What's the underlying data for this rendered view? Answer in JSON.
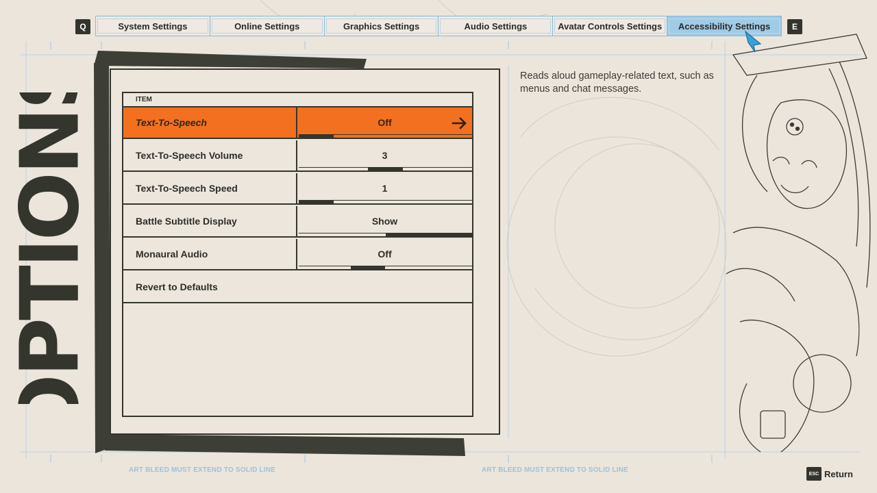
{
  "tabs": {
    "prev_key": "Q",
    "next_key": "E",
    "items": [
      {
        "label": "System Settings",
        "active": false
      },
      {
        "label": "Online Settings",
        "active": false
      },
      {
        "label": "Graphics Settings",
        "active": false
      },
      {
        "label": "Audio Settings",
        "active": false
      },
      {
        "label": "Avatar Controls Settings",
        "active": false
      },
      {
        "label": "Accessibility Settings",
        "active": true
      }
    ]
  },
  "page_title": "OPTIONS",
  "table": {
    "header": "ITEM",
    "rows": [
      {
        "label": "Text-To-Speech",
        "value": "Off",
        "level": 0.2,
        "selected": true
      },
      {
        "label": "Text-To-Speech Volume",
        "value": "3",
        "level": 0.6
      },
      {
        "label": "Text-To-Speech Speed",
        "value": "1",
        "level": 0.2
      },
      {
        "label": "Battle Subtitle Display",
        "value": "Show",
        "level": 0.5
      },
      {
        "label": "Monaural Audio",
        "value": "Off",
        "level": 0.5
      }
    ],
    "revert_label": "Revert to Defaults"
  },
  "description": "Reads aloud gameplay-related text, such as menus and chat messages.",
  "bleed_notes": [
    "ART BLEED MUST EXTEND TO SOLID LINE",
    "ART BLEED MUST EXTEND TO SOLID LINE"
  ],
  "footer": {
    "esc_key": "ESC",
    "return_label": "Return"
  },
  "colors": {
    "accent_orange": "#f2701f",
    "active_tab_blue": "#9fcbe5",
    "ink": "#34352d",
    "paper": "#ece5dc",
    "guide_blue": "#9cc2da"
  }
}
